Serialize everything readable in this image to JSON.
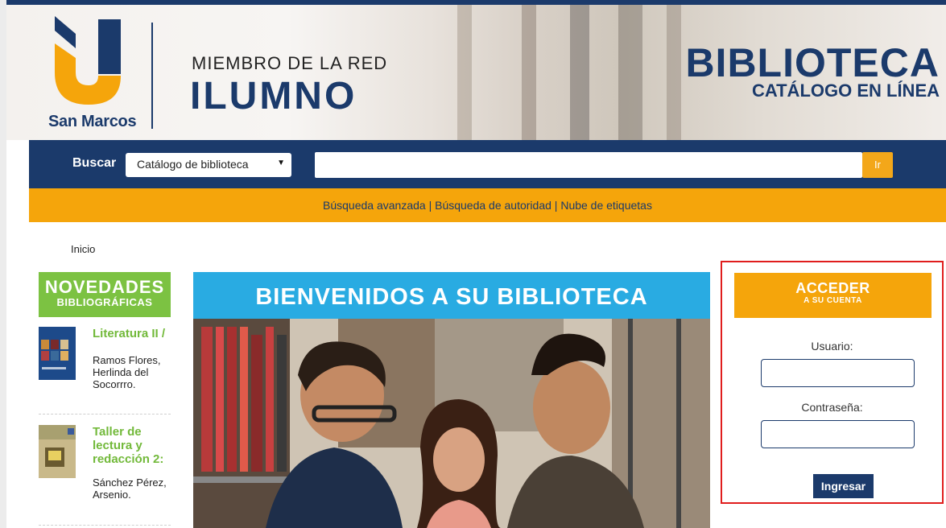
{
  "header": {
    "logo_name": "San Marcos",
    "network_line1": "MIEMBRO DE LA RED",
    "network_line2": "ILUMNO",
    "title": "BIBLIOTECA",
    "subtitle": "CATÁLOGO EN LÍNEA",
    "colors": {
      "navy": "#1b3a6b",
      "orange": "#f5a50b",
      "green": "#7cc242",
      "sky": "#29abe2"
    }
  },
  "search": {
    "label": "Buscar",
    "scope_selected": "Catálogo de biblioteca",
    "query_value": "",
    "go_label": "Ir"
  },
  "links": {
    "advanced": "Búsqueda avanzada",
    "authority": "Búsqueda de autoridad",
    "tags": "Nube de etiquetas",
    "separator": "|"
  },
  "breadcrumb": {
    "home": "Inicio"
  },
  "novedades": {
    "title_line1": "NOVEDADES",
    "title_line2": "BIBLIOGRÁFICAS",
    "books": [
      {
        "title": "Literatura II /",
        "author": "Ramos Flores, Herlinda del Socorrro."
      },
      {
        "title": "Taller de lectura y redacción 2:",
        "author": "Sánchez Pérez, Arsenio."
      }
    ]
  },
  "welcome": {
    "title": "BIENVENIDOS A SU BIBLIOTECA"
  },
  "login": {
    "title_line1": "ACCEDER",
    "title_line2": "A SU CUENTA",
    "user_label": "Usuario:",
    "user_value": "",
    "password_label": "Contraseña:",
    "password_value": "",
    "submit_label": "Ingresar"
  }
}
